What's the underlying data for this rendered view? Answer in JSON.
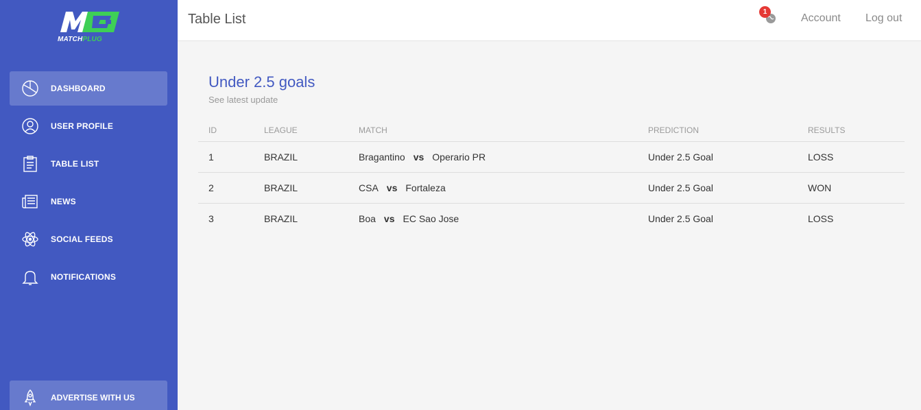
{
  "brand": {
    "logo_text": "M",
    "sub_white": "MATCH",
    "sub_green": "PLUG",
    "green": "#3ecf56"
  },
  "sidebar": {
    "items": [
      {
        "label": "DASHBOARD",
        "icon": "pie-chart-icon"
      },
      {
        "label": "USER PROFILE",
        "icon": "user-icon"
      },
      {
        "label": "TABLE LIST",
        "icon": "clipboard-icon"
      },
      {
        "label": "NEWS",
        "icon": "newspaper-icon"
      },
      {
        "label": "SOCIAL FEEDS",
        "icon": "atom-icon"
      },
      {
        "label": "NOTIFICATIONS",
        "icon": "bell-icon"
      }
    ],
    "bottom": {
      "label": "ADVERTISE WITH US",
      "icon": "rocket-icon"
    }
  },
  "header": {
    "title": "Table List",
    "notifications_count": "1",
    "account": "Account",
    "logout": "Log out"
  },
  "card": {
    "title": "Under 2.5 goals",
    "subtitle": "See latest update"
  },
  "table": {
    "columns": [
      "ID",
      "LEAGUE",
      "MATCH",
      "PREDICTION",
      "RESULTS"
    ],
    "vs_label": "vs",
    "rows": [
      {
        "id": "1",
        "league": "BRAZIL",
        "home": "Bragantino",
        "away": "Operario PR",
        "prediction": "Under 2.5 Goal",
        "result": "LOSS"
      },
      {
        "id": "2",
        "league": "BRAZIL",
        "home": "CSA",
        "away": "Fortaleza",
        "prediction": "Under 2.5 Goal",
        "result": "WON"
      },
      {
        "id": "3",
        "league": "BRAZIL",
        "home": "Boa",
        "away": "EC Sao Jose",
        "prediction": "Under 2.5 Goal",
        "result": "LOSS"
      }
    ]
  },
  "colors": {
    "sidebar": "#4259c1",
    "accent": "#4259c1",
    "badge": "#e53935"
  }
}
